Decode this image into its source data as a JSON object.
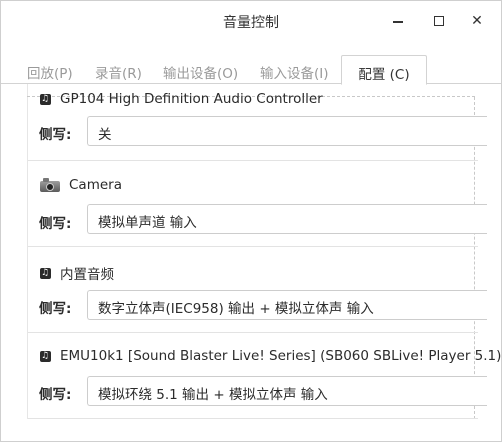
{
  "window": {
    "title": "音量控制"
  },
  "tabs": [
    {
      "label": "回放(P)"
    },
    {
      "label": "录音(R)"
    },
    {
      "label": "输出设备(O)"
    },
    {
      "label": "输入设备(I)"
    },
    {
      "label": "配置 (C)"
    }
  ],
  "active_tab": 4,
  "profile_label": "侧写:",
  "cards": [
    {
      "icon": "audio-card-icon",
      "name": "GP104 High Definition Audio Controller",
      "profile": "关"
    },
    {
      "icon": "camera-icon",
      "name": "Camera",
      "profile": "模拟单声道 输入"
    },
    {
      "icon": "audio-card-icon",
      "name": "内置音频",
      "profile": "数字立体声(IEC958) 输出 + 模拟立体声 输入"
    },
    {
      "icon": "audio-card-icon",
      "name": "EMU10k1 [Sound Blaster Live! Series] (SB060 SBLive! Player 5.1)",
      "profile": "模拟环绕 5.1 输出 + 模拟立体声 输入"
    }
  ]
}
